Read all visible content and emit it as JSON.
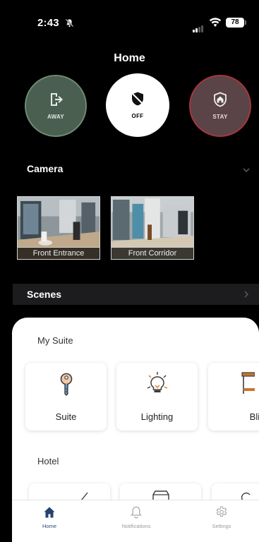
{
  "status_bar": {
    "time": "2:43",
    "battery": "78"
  },
  "header": {
    "title": "Home"
  },
  "modes": [
    {
      "label": "AWAY",
      "icon": "exit-icon"
    },
    {
      "label": "OFF",
      "icon": "shield-off-icon"
    },
    {
      "label": "STAY",
      "icon": "shield-home-icon"
    }
  ],
  "camera": {
    "label": "Camera",
    "feeds": [
      {
        "caption": "Front Entrance"
      },
      {
        "caption": "Front Corridor"
      }
    ]
  },
  "scenes": {
    "label": "Scenes"
  },
  "my_suite": {
    "label": "My Suite",
    "tiles": [
      {
        "label": "Suite",
        "icon": "key-icon"
      },
      {
        "label": "Lighting",
        "icon": "light-bulb-icon"
      },
      {
        "label": "Blin",
        "icon": "blinds-icon"
      }
    ]
  },
  "hotel": {
    "label": "Hotel"
  },
  "tabbar": {
    "items": [
      {
        "label": "Home",
        "icon": "home-icon",
        "active": true
      },
      {
        "label": "Notifications",
        "icon": "bell-icon",
        "active": false
      },
      {
        "label": "Settings",
        "icon": "gear-icon",
        "active": false
      }
    ]
  },
  "colors": {
    "away_bg": "#4a5f50",
    "stay_border": "#a7363e",
    "accent_blue": "#2b4a7a",
    "bulb_orange": "#e07a1f"
  }
}
